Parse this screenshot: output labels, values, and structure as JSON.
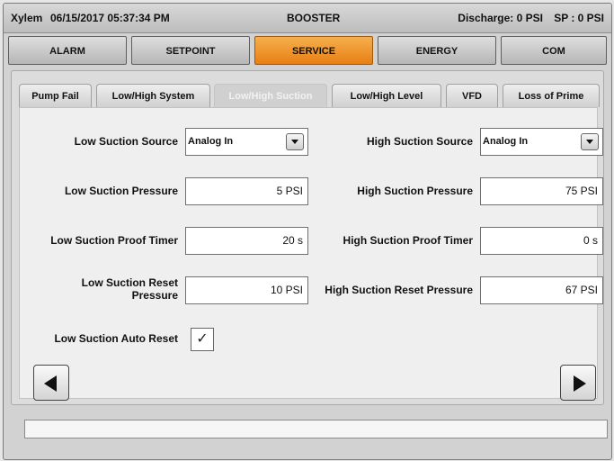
{
  "titlebar": {
    "brand": "Xylem",
    "datetime": "06/15/2017 05:37:34 PM",
    "screen": "BOOSTER",
    "discharge": "Discharge: 0 PSI",
    "setpoint": "SP : 0 PSI"
  },
  "main_tabs": [
    "ALARM",
    "SETPOINT",
    "SERVICE",
    "ENERGY",
    "COM"
  ],
  "sub_tabs": [
    "Pump Fail",
    "Low/High System",
    "Low/High Suction",
    "Low/High Level",
    "VFD",
    "Loss of Prime"
  ],
  "form": {
    "low_source_label": "Low Suction Source",
    "low_source_value": "Analog In",
    "high_source_label": "High Suction Source",
    "high_source_value": "Analog In",
    "low_pressure_label": "Low Suction Pressure",
    "low_pressure_value": "5 PSI",
    "high_pressure_label": "High Suction Pressure",
    "high_pressure_value": "75 PSI",
    "low_proof_label": "Low Suction Proof Timer",
    "low_proof_value": "20 s",
    "high_proof_label": "High Suction Proof Timer",
    "high_proof_value": "0 s",
    "low_reset_label": "Low Suction Reset Pressure",
    "low_reset_value": "10 PSI",
    "high_reset_label": "High Suction Reset Pressure",
    "high_reset_value": "67 PSI",
    "auto_reset_label": "Low Suction Auto Reset",
    "auto_reset_mark": "✓"
  },
  "colors": {
    "active_main_tab": "#f09a2a",
    "panel": "#dcdcdc"
  },
  "icons": {
    "prev": "left-arrow-icon",
    "next": "right-arrow-icon",
    "dropdown": "chevron-down-icon"
  }
}
